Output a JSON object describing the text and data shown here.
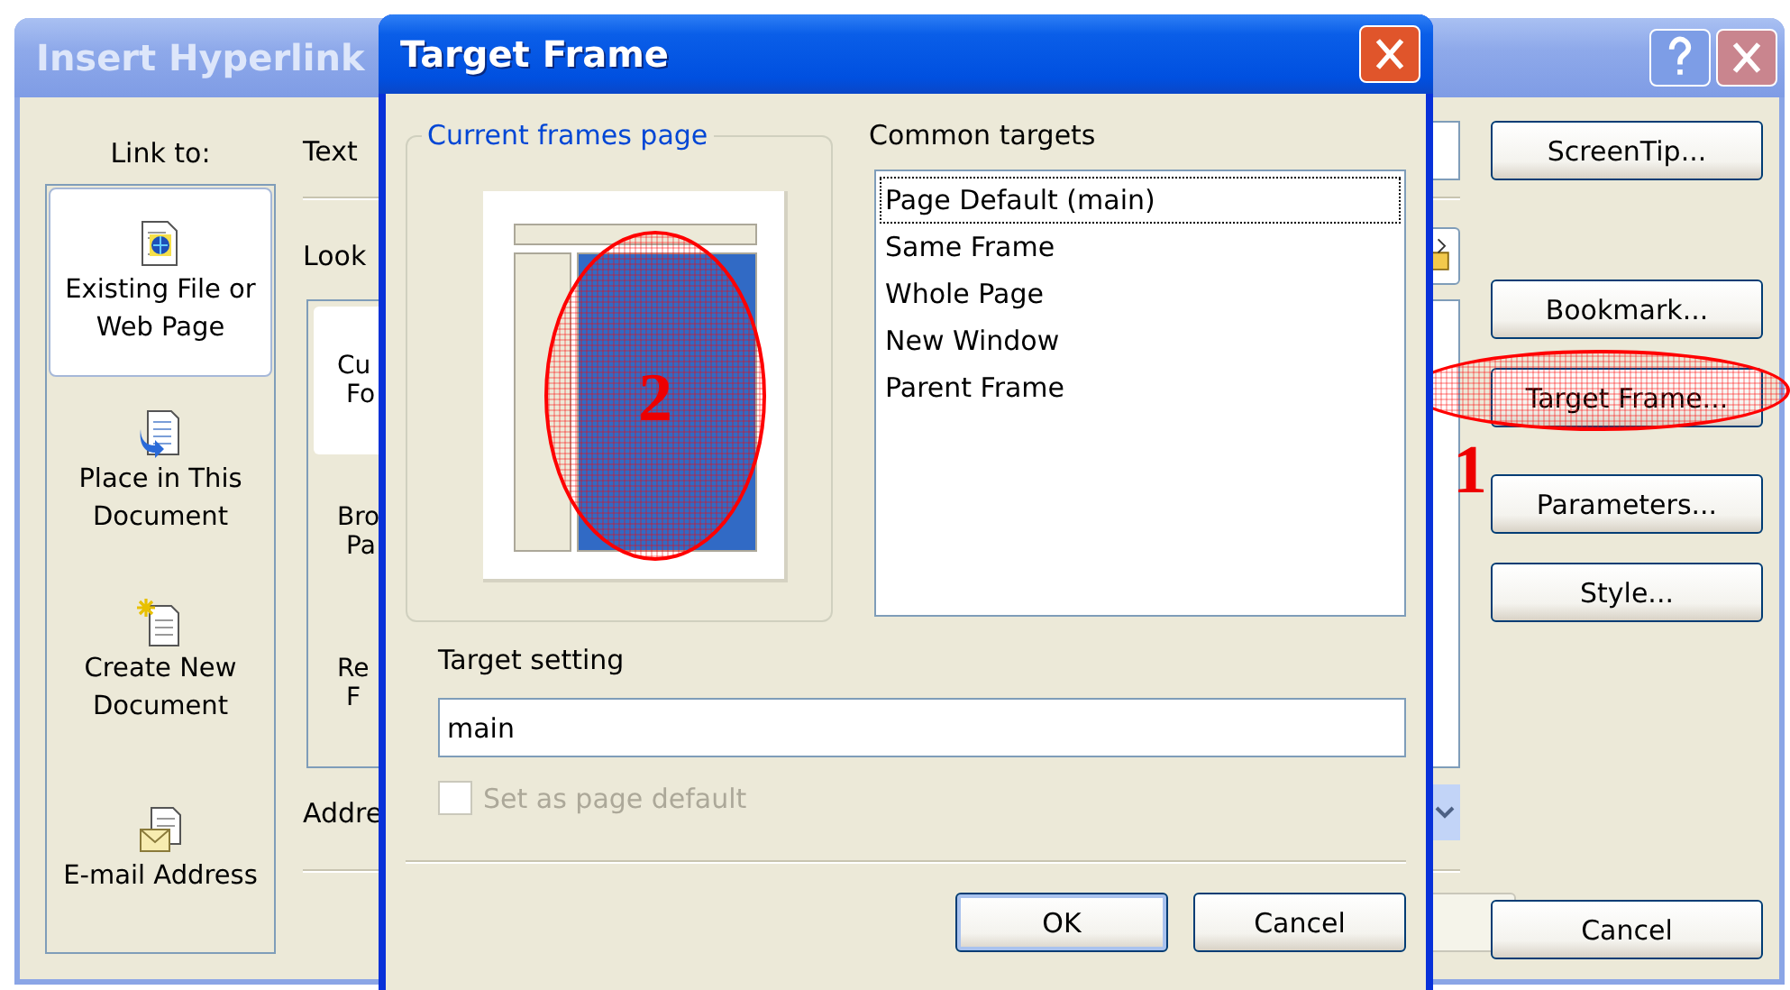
{
  "insert_hyperlink": {
    "title": "Insert Hyperlink",
    "link_to_label": "Link to:",
    "link_to_items": [
      {
        "kind": "existing-file",
        "label": "Existing File or Web Page",
        "selected": true
      },
      {
        "kind": "place-in-document",
        "label": "Place in This Document",
        "selected": false
      },
      {
        "kind": "new-document",
        "label": "Create New Document",
        "selected": false
      },
      {
        "kind": "email",
        "label": "E-mail Address",
        "selected": false
      }
    ],
    "text_label": "Text",
    "look_in_label": "Look",
    "browse_items": [
      {
        "lines": [
          "Cu",
          "Fo"
        ],
        "selected": true
      },
      {
        "lines": [
          "Bro",
          "Pa"
        ],
        "selected": false
      },
      {
        "lines": [
          "Re",
          "F"
        ],
        "selected": false
      }
    ],
    "address_label": "Addre",
    "side_buttons": [
      {
        "label": "ScreenTip..."
      },
      {
        "label": "Bookmark..."
      },
      {
        "label": "Target Frame...",
        "callout": "1"
      },
      {
        "label": "Parameters..."
      },
      {
        "label": "Style..."
      }
    ],
    "cancel_button": "Cancel"
  },
  "target_frame": {
    "title": "Target Frame",
    "frames_group_label": "Current frames page",
    "frames_preview": {
      "callout": "2"
    },
    "common_targets_label": "Common targets",
    "common_targets": [
      {
        "label": "Page Default (main)",
        "selected": true
      },
      {
        "label": "Same Frame",
        "selected": false
      },
      {
        "label": "Whole Page",
        "selected": false
      },
      {
        "label": "New Window",
        "selected": false
      },
      {
        "label": "Parent Frame",
        "selected": false
      }
    ],
    "target_setting_label": "Target setting",
    "target_setting_value": "main",
    "set_default": {
      "label": "Set as page default",
      "checked": false,
      "disabled": true
    },
    "ok_button": "OK",
    "cancel_button": "Cancel"
  }
}
